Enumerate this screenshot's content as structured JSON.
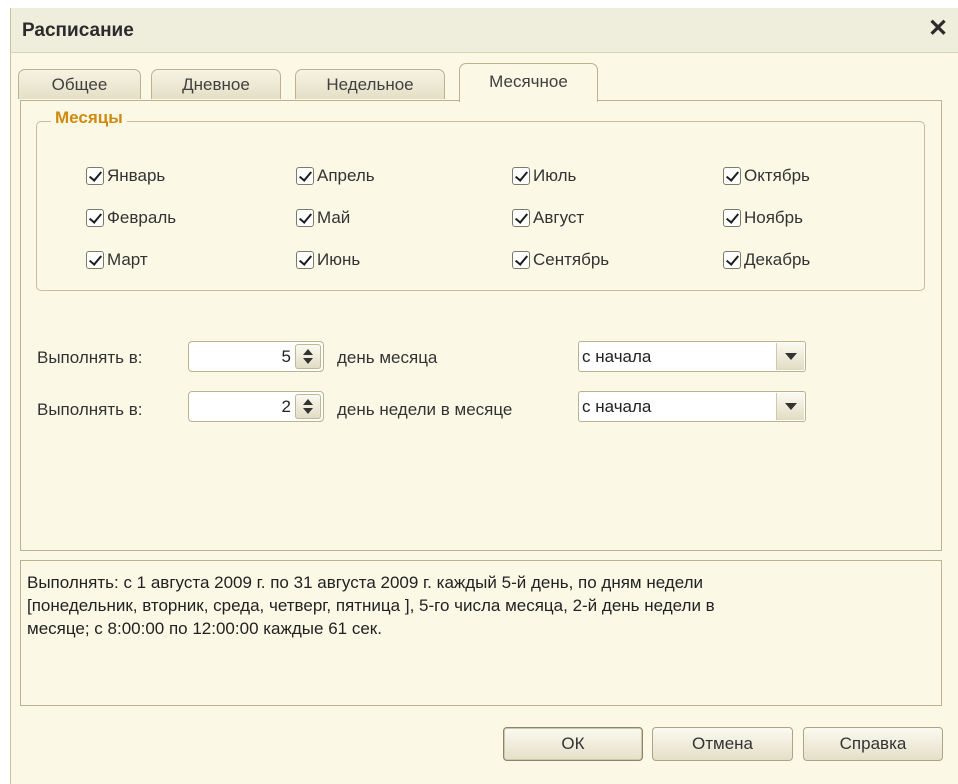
{
  "window": {
    "title": "Расписание",
    "close_label": "✕"
  },
  "tabs": [
    {
      "label": "Общее"
    },
    {
      "label": "Дневное"
    },
    {
      "label": "Недельное"
    },
    {
      "label": "Месячное"
    }
  ],
  "months_group": {
    "title": "Месяцы",
    "months": [
      {
        "label": "Январь",
        "checked": true
      },
      {
        "label": "Февраль",
        "checked": true
      },
      {
        "label": "Март",
        "checked": true
      },
      {
        "label": "Апрель",
        "checked": true
      },
      {
        "label": "Май",
        "checked": true
      },
      {
        "label": "Июнь",
        "checked": true
      },
      {
        "label": "Июль",
        "checked": true
      },
      {
        "label": "Август",
        "checked": true
      },
      {
        "label": "Сентябрь",
        "checked": true
      },
      {
        "label": "Октябрь",
        "checked": true
      },
      {
        "label": "Ноябрь",
        "checked": true
      },
      {
        "label": "Декабрь",
        "checked": true
      }
    ]
  },
  "rows": [
    {
      "label": "Выполнять в:",
      "value": "5",
      "suffix": "день месяца",
      "select": "с начала"
    },
    {
      "label": "Выполнять в:",
      "value": "2",
      "suffix": "день недели в месяце",
      "select": "с начала"
    }
  ],
  "summary": {
    "line1": "Выполнять: с 1 августа 2009 г. по 31 августа 2009 г. каждый 5-й день, по дням недели",
    "line2": "[понедельник, вторник, среда, четверг, пятница ], 5-го числа месяца, 2-й день недели в",
    "line3": "месяце; с 8:00:00 по 12:00:00 каждые 61 сек."
  },
  "buttons": {
    "ok": "ОК",
    "cancel": "Отмена",
    "help": "Справка"
  }
}
